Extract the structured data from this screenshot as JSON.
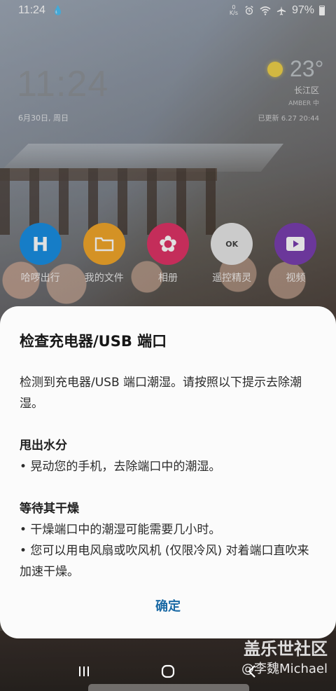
{
  "status": {
    "time": "11:24",
    "net_speed_top": "0",
    "net_speed_bottom": "K/s",
    "battery": "97%"
  },
  "lock": {
    "clock": "11:24",
    "date": "6月30日, 周日",
    "temperature": "23°",
    "location": "长江区",
    "weather_sub": "AMBER 中",
    "updated": "已更新 6.27 20:44"
  },
  "apps": [
    {
      "label": "哈啰出行",
      "icon": "hello-bike-icon",
      "color": "#1a8fe3",
      "glyph": "H"
    },
    {
      "label": "我的文件",
      "icon": "folder-icon",
      "color": "#f2a72b",
      "glyph": "▭"
    },
    {
      "label": "相册",
      "icon": "flower-icon",
      "color": "#e03467",
      "glyph": "✿"
    },
    {
      "label": "遥控精灵",
      "icon": "remote-icon",
      "color": "#e8e8e8",
      "glyph": "OK"
    },
    {
      "label": "视频",
      "icon": "video-icon",
      "color": "#7a3fb0",
      "glyph": "▶"
    }
  ],
  "dialog": {
    "title": "检查充电器/USB 端口",
    "intro": "检测到充电器/USB 端口潮湿。请按照以下提示去除潮湿。",
    "section1_title": "甩出水分",
    "section1_item1": "• 晃动您的手机，去除端口中的潮湿。",
    "section2_title": "等待其干燥",
    "section2_item1": "• 干燥端口中的潮湿可能需要几小时。",
    "section2_item2": "• 您可以用电风扇或吹风机 (仅限冷风) 对着端口直吹来加速干燥。",
    "confirm": "确定"
  },
  "watermark": {
    "line1": "盖乐世社区",
    "line2": "@李魏Michael"
  },
  "nav": {
    "recents": "|||",
    "home": "◯",
    "back": "‹"
  }
}
